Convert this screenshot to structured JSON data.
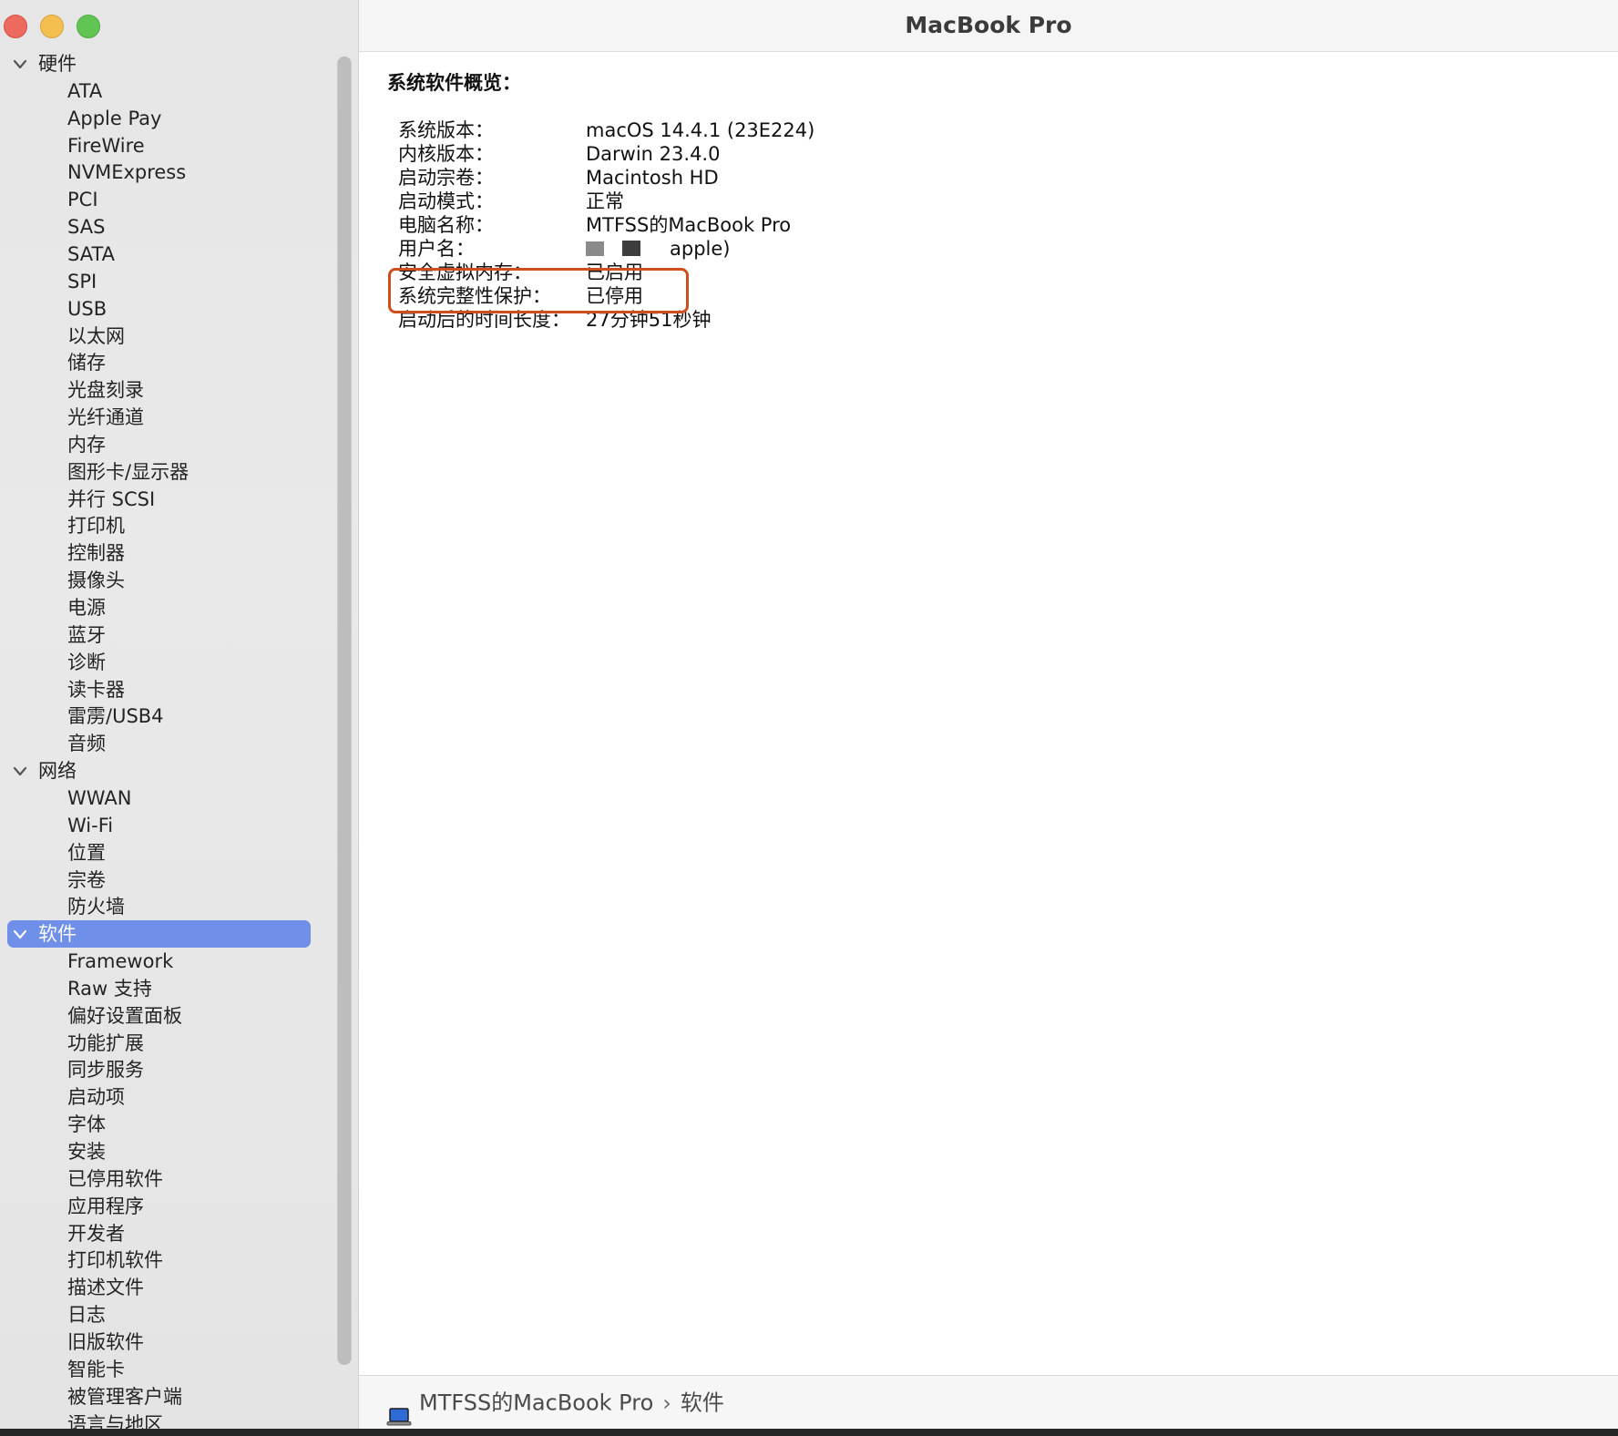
{
  "window": {
    "title": "MacBook Pro"
  },
  "sidebar": {
    "groups": [
      {
        "label": "硬件",
        "children": [
          "ATA",
          "Apple Pay",
          "FireWire",
          "NVMExpress",
          "PCI",
          "SAS",
          "SATA",
          "SPI",
          "USB",
          "以太网",
          "储存",
          "光盘刻录",
          "光纤通道",
          "内存",
          "图形卡/显示器",
          "并行 SCSI",
          "打印机",
          "控制器",
          "摄像头",
          "电源",
          "蓝牙",
          "诊断",
          "读卡器",
          "雷雳/USB4",
          "音频"
        ]
      },
      {
        "label": "网络",
        "children": [
          "WWAN",
          "Wi-Fi",
          "位置",
          "宗卷",
          "防火墙"
        ]
      },
      {
        "label": "软件",
        "selected": true,
        "children": [
          "Framework",
          "Raw 支持",
          "偏好设置面板",
          "功能扩展",
          "同步服务",
          "启动项",
          "字体",
          "安装",
          "已停用软件",
          "应用程序",
          "开发者",
          "打印机软件",
          "描述文件",
          "日志",
          "旧版软件",
          "智能卡",
          "被管理客户端",
          "语言与地区"
        ]
      }
    ]
  },
  "main": {
    "heading": "系统软件概览：",
    "rows": [
      {
        "label": "系统版本：",
        "value": "macOS 14.4.1 (23E224)"
      },
      {
        "label": "内核版本：",
        "value": "Darwin 23.4.0"
      },
      {
        "label": "启动宗卷：",
        "value": "Macintosh HD"
      },
      {
        "label": "启动模式：",
        "value": "正常"
      },
      {
        "label": "电脑名称：",
        "value": "MTFSS的MacBook Pro"
      },
      {
        "label": "用户名：",
        "value": "apple)"
      },
      {
        "label": "安全虚拟内存：",
        "value": "已启用"
      },
      {
        "label": "系统完整性保护：",
        "value": "已停用"
      },
      {
        "label": "启动后的时间长度：",
        "value": "27分钟51秒钟"
      }
    ]
  },
  "pathbar": {
    "computer": "MTFSS的MacBook Pro",
    "separator": "›",
    "section": "软件"
  },
  "colors": {
    "selection": "#6f8fe8",
    "highlight_box": "#cf4e1e"
  }
}
